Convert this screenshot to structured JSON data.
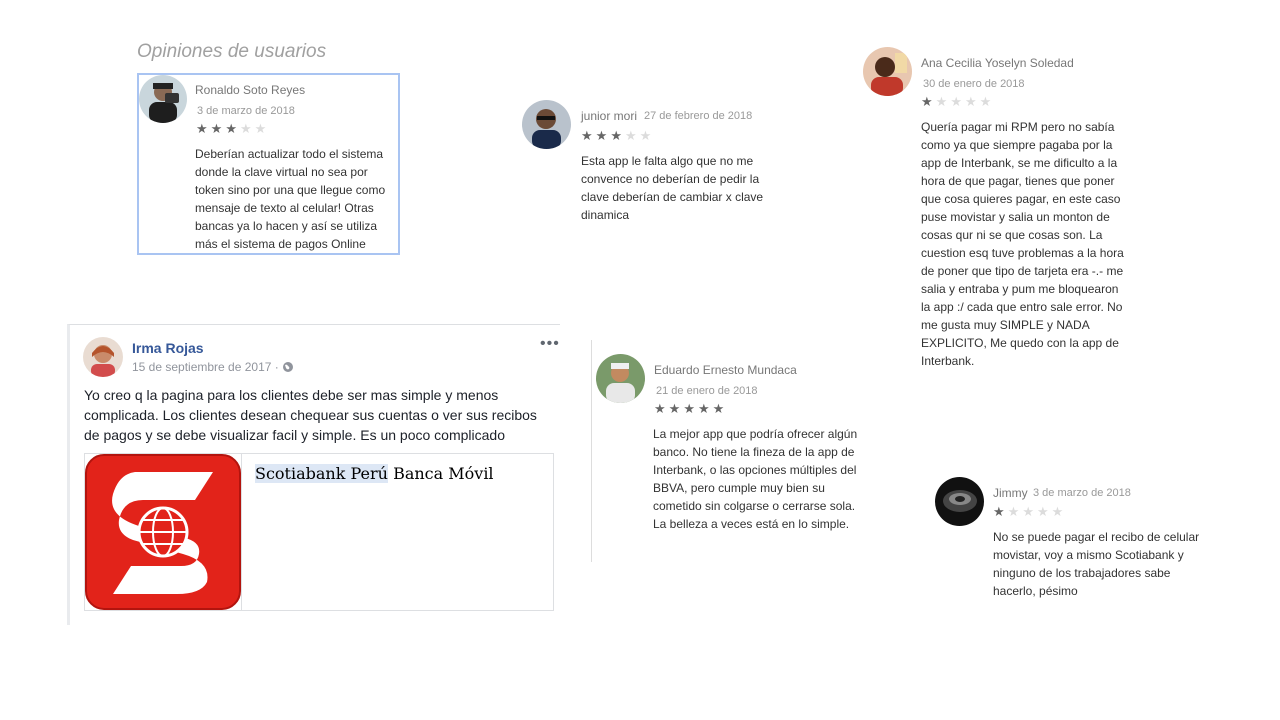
{
  "section_title": "Opiniones de usuarios",
  "reviews": [
    {
      "name": "Ronaldo Soto Reyes",
      "date": "3 de marzo de 2018",
      "rating": 3,
      "text": "Deberían actualizar todo el sistema donde la clave virtual no sea por token sino por una que llegue como mensaje de texto al celular! Otras bancas ya lo hacen y así se utiliza más el sistema de pagos Online"
    },
    {
      "name": "junior mori",
      "date": "27 de febrero de 2018",
      "rating": 3,
      "text": "Esta app le falta algo que no me convence no deberían de pedir la clave deberían de cambiar x clave dinamica"
    },
    {
      "name": "Ana Cecilia Yoselyn Soledad",
      "date": "30 de enero de 2018",
      "rating": 1,
      "text": "Quería pagar mi RPM pero no sabía como ya que siempre pagaba por la app de Interbank, se me dificulto a la hora de que pagar, tienes que poner que cosa quieres pagar, en este caso puse movistar y salia un monton de cosas qur ni se que cosas son. La cuestion esq tuve problemas a la hora de poner que tipo de tarjeta era -.- me salia y entraba y pum me bloquearon la app :/ cada que entro sale error. No me gusta muy SIMPLE y NADA EXPLICITO, Me quedo con la app de Interbank."
    },
    {
      "name": "Eduardo Ernesto Mundaca",
      "date": "21 de enero de 2018",
      "rating": 5,
      "text": "La mejor app que podría ofrecer algún banco. No tiene la fineza de la app de Interbank, o las opciones múltiples del BBVA, pero cumple muy bien su cometido sin colgarse o cerrarse sola. La belleza a veces está en lo simple."
    },
    {
      "name": "Jimmy",
      "date": "3 de marzo de 2018",
      "rating": 1,
      "text": "No se puede pagar el recibo de celular movistar, voy a mismo Scotiabank y ninguno de los trabajadores sabe hacerlo, pésimo"
    }
  ],
  "fb_post": {
    "name": "Irma Rojas",
    "date": "15 de septiembre de 2017 ·",
    "text": "Yo creo q la pagina para los clientes debe ser mas simple y menos complicada. Los clientes desean chequear sus cuentas o ver sus recibos de pagos y se debe visualizar facil y simple. Es un poco complicado",
    "menu": "•••",
    "link_title_highlight": "Scotiabank Perú",
    "link_title_rest": " Banca Móvil"
  },
  "colors": {
    "fb_name": "#365899",
    "scotia_red": "#e2231a",
    "highlight_border": "#a9c4f2"
  }
}
